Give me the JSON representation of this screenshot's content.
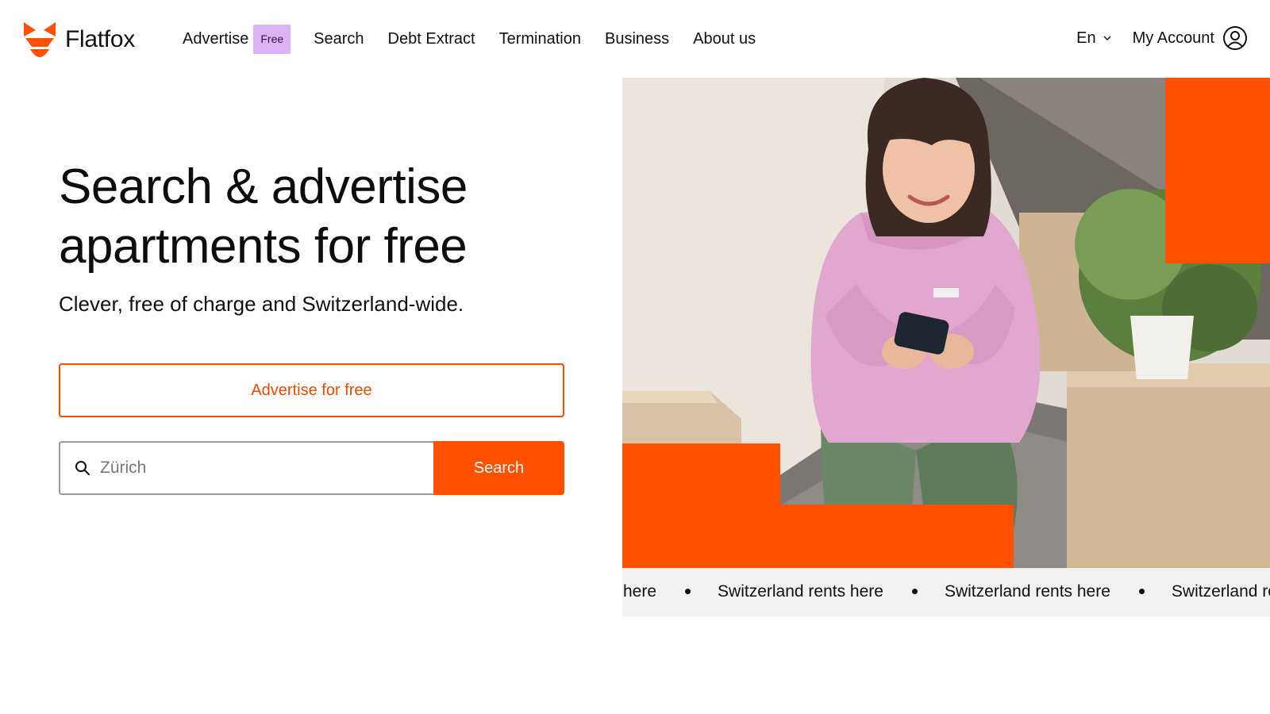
{
  "brand": {
    "name": "Flatfox",
    "accent": "#ff5100",
    "badge_color": "#dcb3f7"
  },
  "nav": {
    "items": [
      {
        "label": "Advertise",
        "badge": "Free"
      },
      {
        "label": "Search"
      },
      {
        "label": "Debt Extract"
      },
      {
        "label": "Termination"
      },
      {
        "label": "Business"
      },
      {
        "label": "About us"
      }
    ]
  },
  "header": {
    "language": "En",
    "account_label": "My Account"
  },
  "hero": {
    "title": "Search & advertise apartments for free",
    "subtitle": "Clever, free of charge and Switzerland-wide.",
    "advertise_button": "Advertise for free",
    "search": {
      "placeholder": "Zürich",
      "button": "Search"
    }
  },
  "ticker": {
    "items": [
      "here",
      "Switzerland rents here",
      "Switzerland rents here",
      "Switzerland rents here"
    ]
  },
  "icons": {
    "logo": "fox-logo-icon",
    "chevron": "chevron-down-icon",
    "account": "user-circle-icon",
    "search": "search-icon"
  }
}
